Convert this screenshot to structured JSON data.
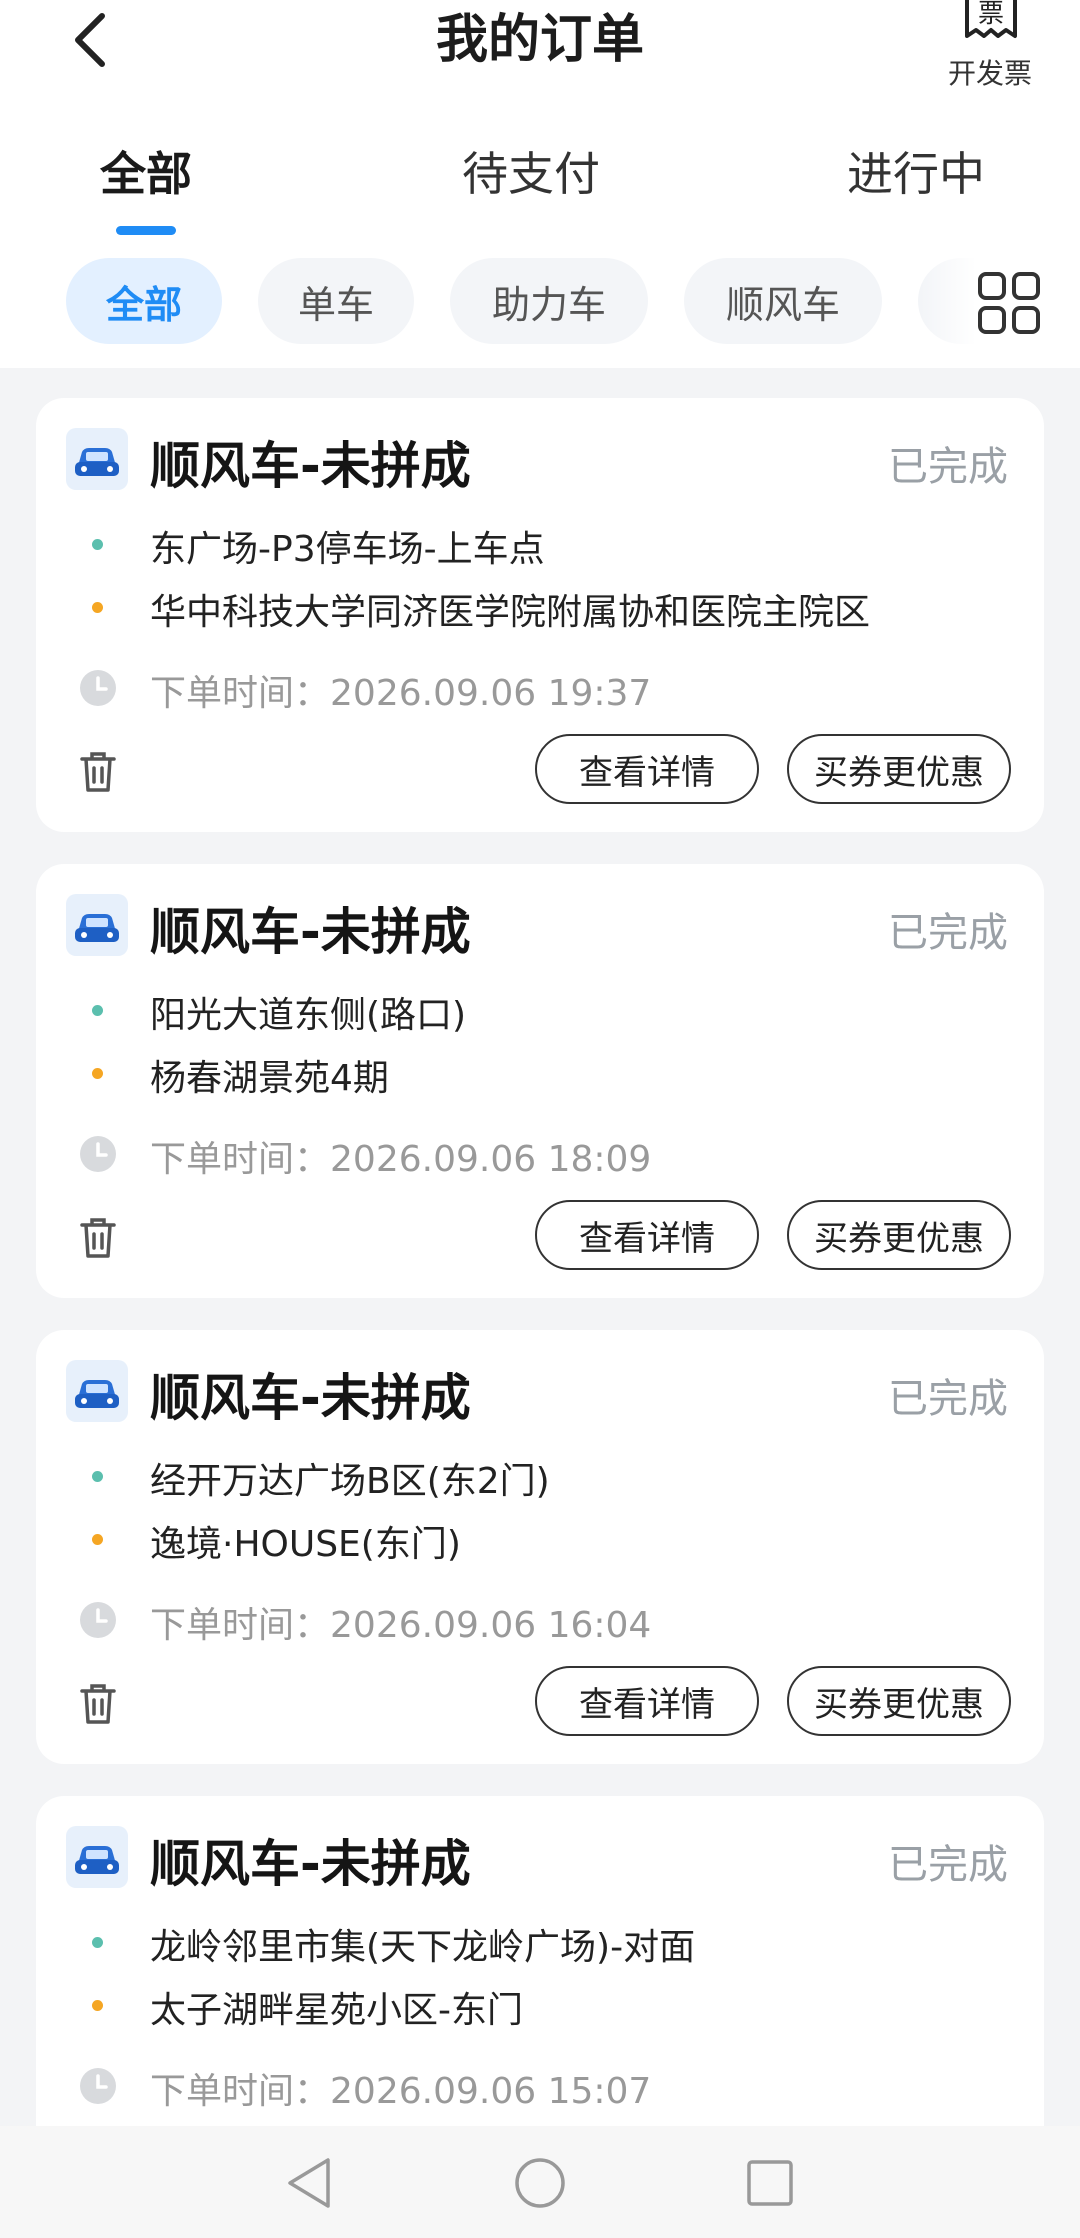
{
  "header": {
    "title": "我的订单",
    "invoice_label": "开发票",
    "invoice_icon_text": "票"
  },
  "tabs": [
    {
      "label": "全部",
      "active": true
    },
    {
      "label": "待支付",
      "active": false
    },
    {
      "label": "进行中",
      "active": false
    }
  ],
  "chips": [
    {
      "label": "全部",
      "active": true
    },
    {
      "label": "单车",
      "active": false
    },
    {
      "label": "助力车",
      "active": false
    },
    {
      "label": "顺风车",
      "active": false
    }
  ],
  "orders": [
    {
      "title": "顺风车-未拼成",
      "status": "已完成",
      "start": "东广场-P3停车场-上车点",
      "end": "华中科技大学同济医学院附属协和医院主院区",
      "time_label": "下单时间：",
      "time": "2026.09.06 19:37",
      "detail_label": "查看详情",
      "coupon_label": "买券更优惠"
    },
    {
      "title": "顺风车-未拼成",
      "status": "已完成",
      "start": "阳光大道东侧(路口)",
      "end": "杨春湖景苑4期",
      "time_label": "下单时间：",
      "time": "2026.09.06 18:09",
      "detail_label": "查看详情",
      "coupon_label": "买券更优惠"
    },
    {
      "title": "顺风车-未拼成",
      "status": "已完成",
      "start": "经开万达广场B区(东2门)",
      "end": "逸境·HOUSE(东门)",
      "time_label": "下单时间：",
      "time": "2026.09.06 16:04",
      "detail_label": "查看详情",
      "coupon_label": "买券更优惠"
    },
    {
      "title": "顺风车-未拼成",
      "status": "已完成",
      "start": "龙岭邻里市集(天下龙岭广场)-对面",
      "end": "太子湖畔星苑小区-东门",
      "time_label": "下单时间：",
      "time": "2026.09.06 15:07"
    }
  ],
  "colors": {
    "accent": "#1f8cf5",
    "start_dot": "#5bbfae",
    "end_dot": "#f5a623"
  },
  "icons": {
    "back": "chevron-left-icon",
    "invoice": "receipt-icon",
    "category_grid": "grid-icon",
    "car": "car-icon",
    "clock": "clock-icon",
    "delete": "trash-icon"
  }
}
